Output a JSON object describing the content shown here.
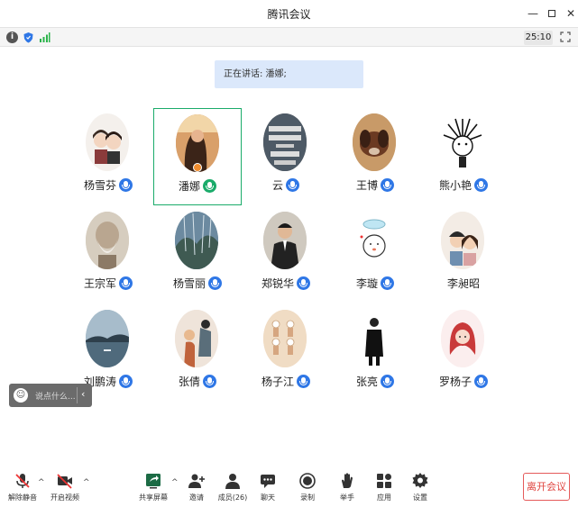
{
  "window": {
    "title": "腾讯会议"
  },
  "status": {
    "timer": "25:10"
  },
  "speaking_banner": "正在讲话: 潘娜;",
  "participants": [
    {
      "name": "杨雪芬"
    },
    {
      "name": "潘娜"
    },
    {
      "name": "云"
    },
    {
      "name": "王博"
    },
    {
      "name": "熊小艳"
    },
    {
      "name": "王宗军"
    },
    {
      "name": "杨雪丽"
    },
    {
      "name": "郑锐华"
    },
    {
      "name": "李璇"
    },
    {
      "name": "李昶昭"
    },
    {
      "name": "刘鹏涛"
    },
    {
      "name": "张倩"
    },
    {
      "name": "杨子江"
    },
    {
      "name": "张亮"
    },
    {
      "name": "罗杨子"
    }
  ],
  "chat": {
    "placeholder": "说点什么..."
  },
  "toolbar": {
    "unmute": "解除静音",
    "video": "开启视频",
    "share": "共享屏幕",
    "invite": "邀请",
    "members": "成员(26)",
    "chat": "聊天",
    "record": "录制",
    "raise_hand": "举手",
    "apps": "应用",
    "settings": "设置",
    "leave": "离开会议"
  },
  "colors": {
    "accent": "#2f77e6",
    "speaking_green": "#1aab6a",
    "leave_red": "#e0443f"
  }
}
